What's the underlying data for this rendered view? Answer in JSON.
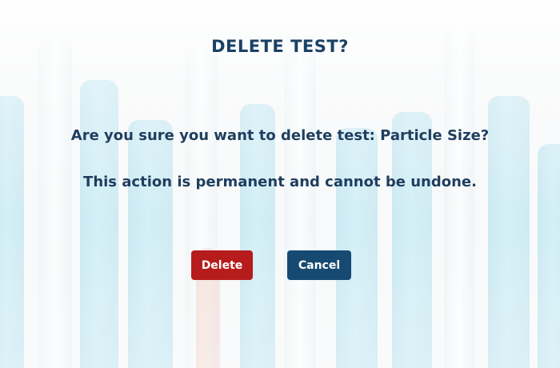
{
  "dialog": {
    "title": "DELETE TEST?",
    "confirm_message": "Are you sure you want to delete test: Particle Size?",
    "warning_message": "This action is permanent and cannot be undone.",
    "delete_label": "Delete",
    "cancel_label": "Cancel"
  },
  "colors": {
    "title": "#1a4166",
    "text": "#1f3e5f",
    "delete_button": "#b71c1c",
    "cancel_button": "#164a72"
  }
}
